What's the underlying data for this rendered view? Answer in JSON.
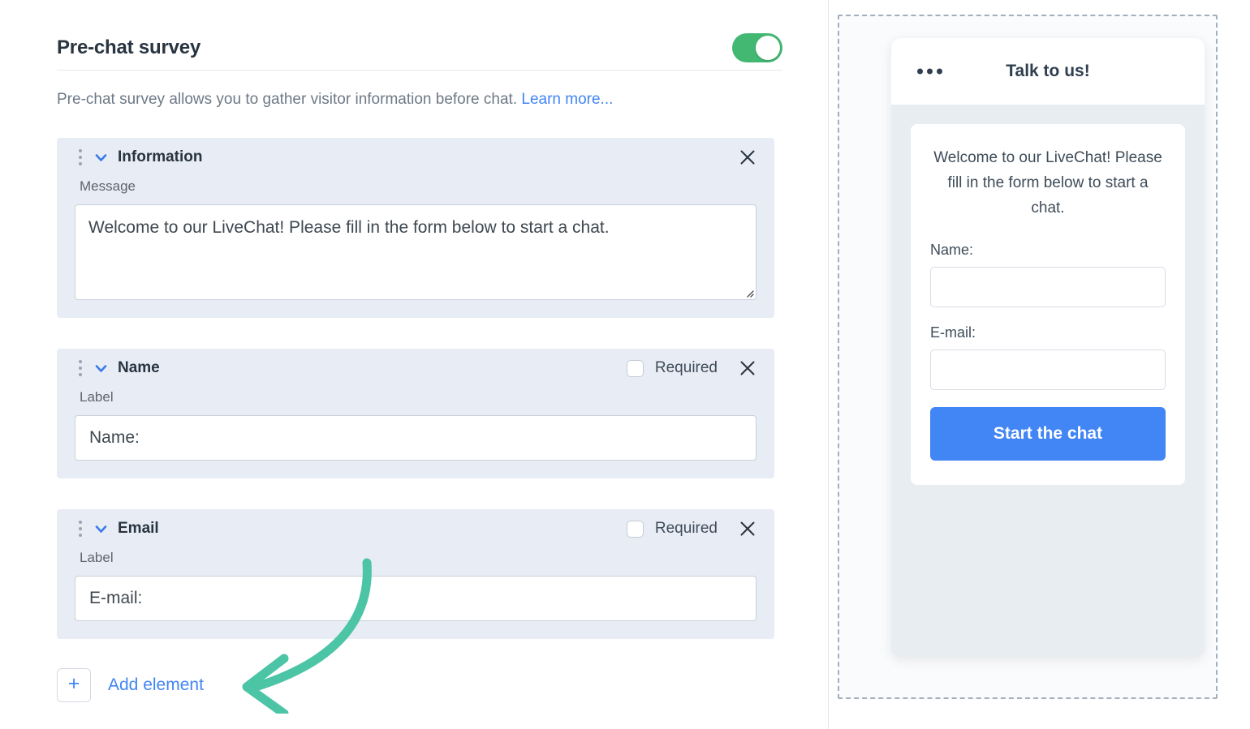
{
  "editor": {
    "title": "Pre-chat survey",
    "toggle": {
      "state": "on",
      "color": "#42B872"
    },
    "description_prefix": "Pre-chat survey allows you to gather visitor information before chat. ",
    "learn_more": "Learn more...",
    "link_color": "#4285F4",
    "sections": [
      {
        "title": "Information",
        "field_label": "Message",
        "value": "Welcome to our LiveChat! Please fill in the form below to start a chat.",
        "field_type": "textarea",
        "has_required": false,
        "required_label": "",
        "required_checked": false
      },
      {
        "title": "Name",
        "field_label": "Label",
        "value": "Name:",
        "field_type": "input",
        "has_required": true,
        "required_label": "Required",
        "required_checked": false
      },
      {
        "title": "Email",
        "field_label": "Label",
        "value": "E-mail:",
        "field_type": "input",
        "has_required": true,
        "required_label": "Required",
        "required_checked": false
      }
    ],
    "add_element": {
      "plus": "+",
      "label": "Add element"
    },
    "annotation": {
      "type": "curved-arrow",
      "color": "#4CC4A6",
      "points_to": "Add element"
    }
  },
  "preview": {
    "widget": {
      "header_title": "Talk to us!",
      "menu_icon": "dots-horizontal",
      "welcome_message": "Welcome to our LiveChat! Please fill in the form below to start a chat.",
      "fields": [
        {
          "label": "Name:",
          "value": ""
        },
        {
          "label": "E-mail:",
          "value": ""
        }
      ],
      "submit_label": "Start the chat",
      "submit_color": "#4285F4"
    }
  }
}
